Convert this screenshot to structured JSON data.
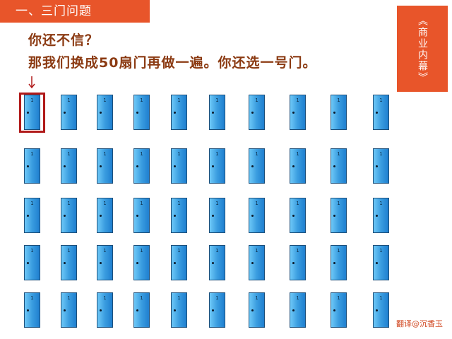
{
  "header": {
    "title": "一、三门问题"
  },
  "side_tag": {
    "text": "《商业内幕》"
  },
  "content": {
    "line1": "你还不信？",
    "line2": "那我们换成50扇门再做一遍。你还选一号门。"
  },
  "doors": {
    "rows": 5,
    "cols": 10,
    "label": "1",
    "selected_index": 0
  },
  "credit": {
    "text": "翻译@沉香玉"
  },
  "colors": {
    "accent": "#e8552a",
    "text_brown": "#8b3a12",
    "door_blue": "#3a9de0",
    "selection_red": "#b01a1a"
  }
}
